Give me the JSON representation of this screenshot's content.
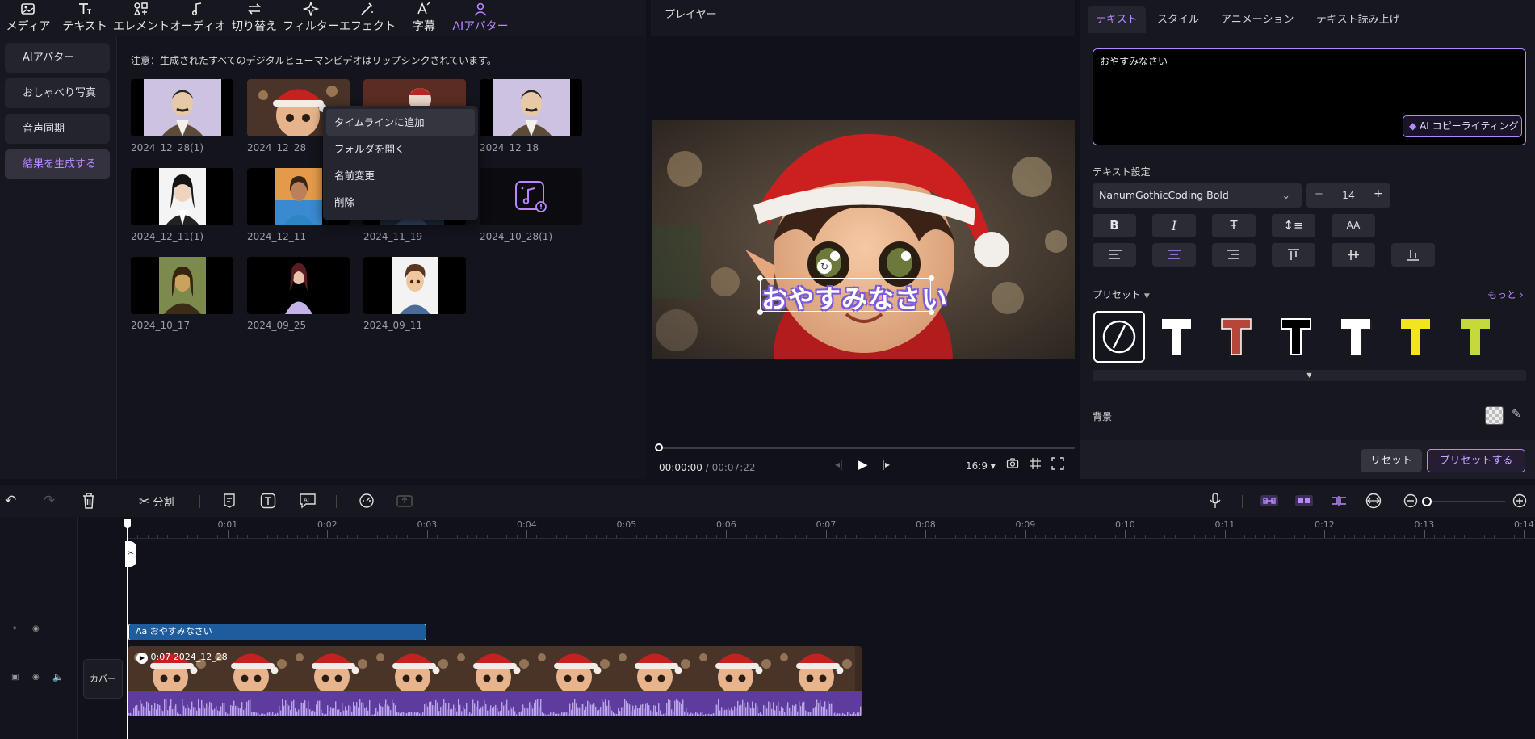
{
  "toolbar": {
    "tools": [
      {
        "label": "メディア",
        "icon": "media-icon"
      },
      {
        "label": "テキスト",
        "icon": "text-icon"
      },
      {
        "label": "エレメント",
        "icon": "element-icon"
      },
      {
        "label": "オーディオ",
        "icon": "audio-icon"
      },
      {
        "label": "切り替え",
        "icon": "transition-icon"
      },
      {
        "label": "フィルター",
        "icon": "filter-icon"
      },
      {
        "label": "エフェクト",
        "icon": "effect-icon"
      },
      {
        "label": "字幕",
        "icon": "subtitle-icon"
      },
      {
        "label": "AIアバター",
        "icon": "ai-avatar-icon"
      }
    ]
  },
  "sidebar": {
    "items": [
      {
        "label": "AIアバター"
      },
      {
        "label": "おしゃべり写真"
      },
      {
        "label": "音声同期"
      },
      {
        "label": "結果を生成する"
      }
    ]
  },
  "media": {
    "notice": "注意：生成されたすべてのデジタルヒューマンビデオはリップシンクされています。",
    "items": [
      {
        "label": "2024_12_28(1)"
      },
      {
        "label": "2024_12_28"
      },
      {
        "label": ""
      },
      {
        "label": "2024_12_18"
      },
      {
        "label": "2024_12_11(1)"
      },
      {
        "label": "2024_12_11"
      },
      {
        "label": "2024_11_19"
      },
      {
        "label": "2024_10_28(1)"
      },
      {
        "label": "2024_10_17"
      },
      {
        "label": "2024_09_25"
      },
      {
        "label": "2024_09_11"
      }
    ]
  },
  "context_menu": {
    "items": [
      "タイムラインに追加",
      "フォルダを開く",
      "名前変更",
      "削除"
    ]
  },
  "player": {
    "title": "プレイヤー",
    "overlay_text": "おやすみなさい",
    "current_time": "00:00:00",
    "separator": "/",
    "total_time": "00:07:22",
    "aspect": "16:9",
    "progress": 0
  },
  "text_panel": {
    "tabs": [
      "テキスト",
      "スタイル",
      "アニメーション",
      "テキスト読み上げ"
    ],
    "content": "おやすみなさい",
    "ai_button": "AI コピーライティング",
    "settings_label": "テキスト設定",
    "font": "NanumGothicCoding Bold",
    "size": "14",
    "minus": "−",
    "plus": "+",
    "aa_label": "AA",
    "preset_label": "プリセット",
    "more_label": "もっと",
    "background_label": "背景",
    "reset_button": "リセット",
    "preset_button": "プリセットする",
    "colors": {
      "accent": "#b887ff",
      "preset_red": "#b5463a",
      "preset_yellow": "#f2e51d",
      "preset_lime": "#c5d83c"
    }
  },
  "timeline": {
    "split_label": "分割",
    "ticks": [
      "0:01",
      "0:02",
      "0:03",
      "0:04",
      "0:05",
      "0:06",
      "0:07",
      "0:08",
      "0:09",
      "0:10",
      "0:11",
      "0:12",
      "0:13",
      "0:14"
    ],
    "text_clip_label": "おやすみなさい",
    "text_clip_prefix": "Aa",
    "video_clip_label": "0:07  2024_12_28",
    "cover_label": "カバー"
  }
}
